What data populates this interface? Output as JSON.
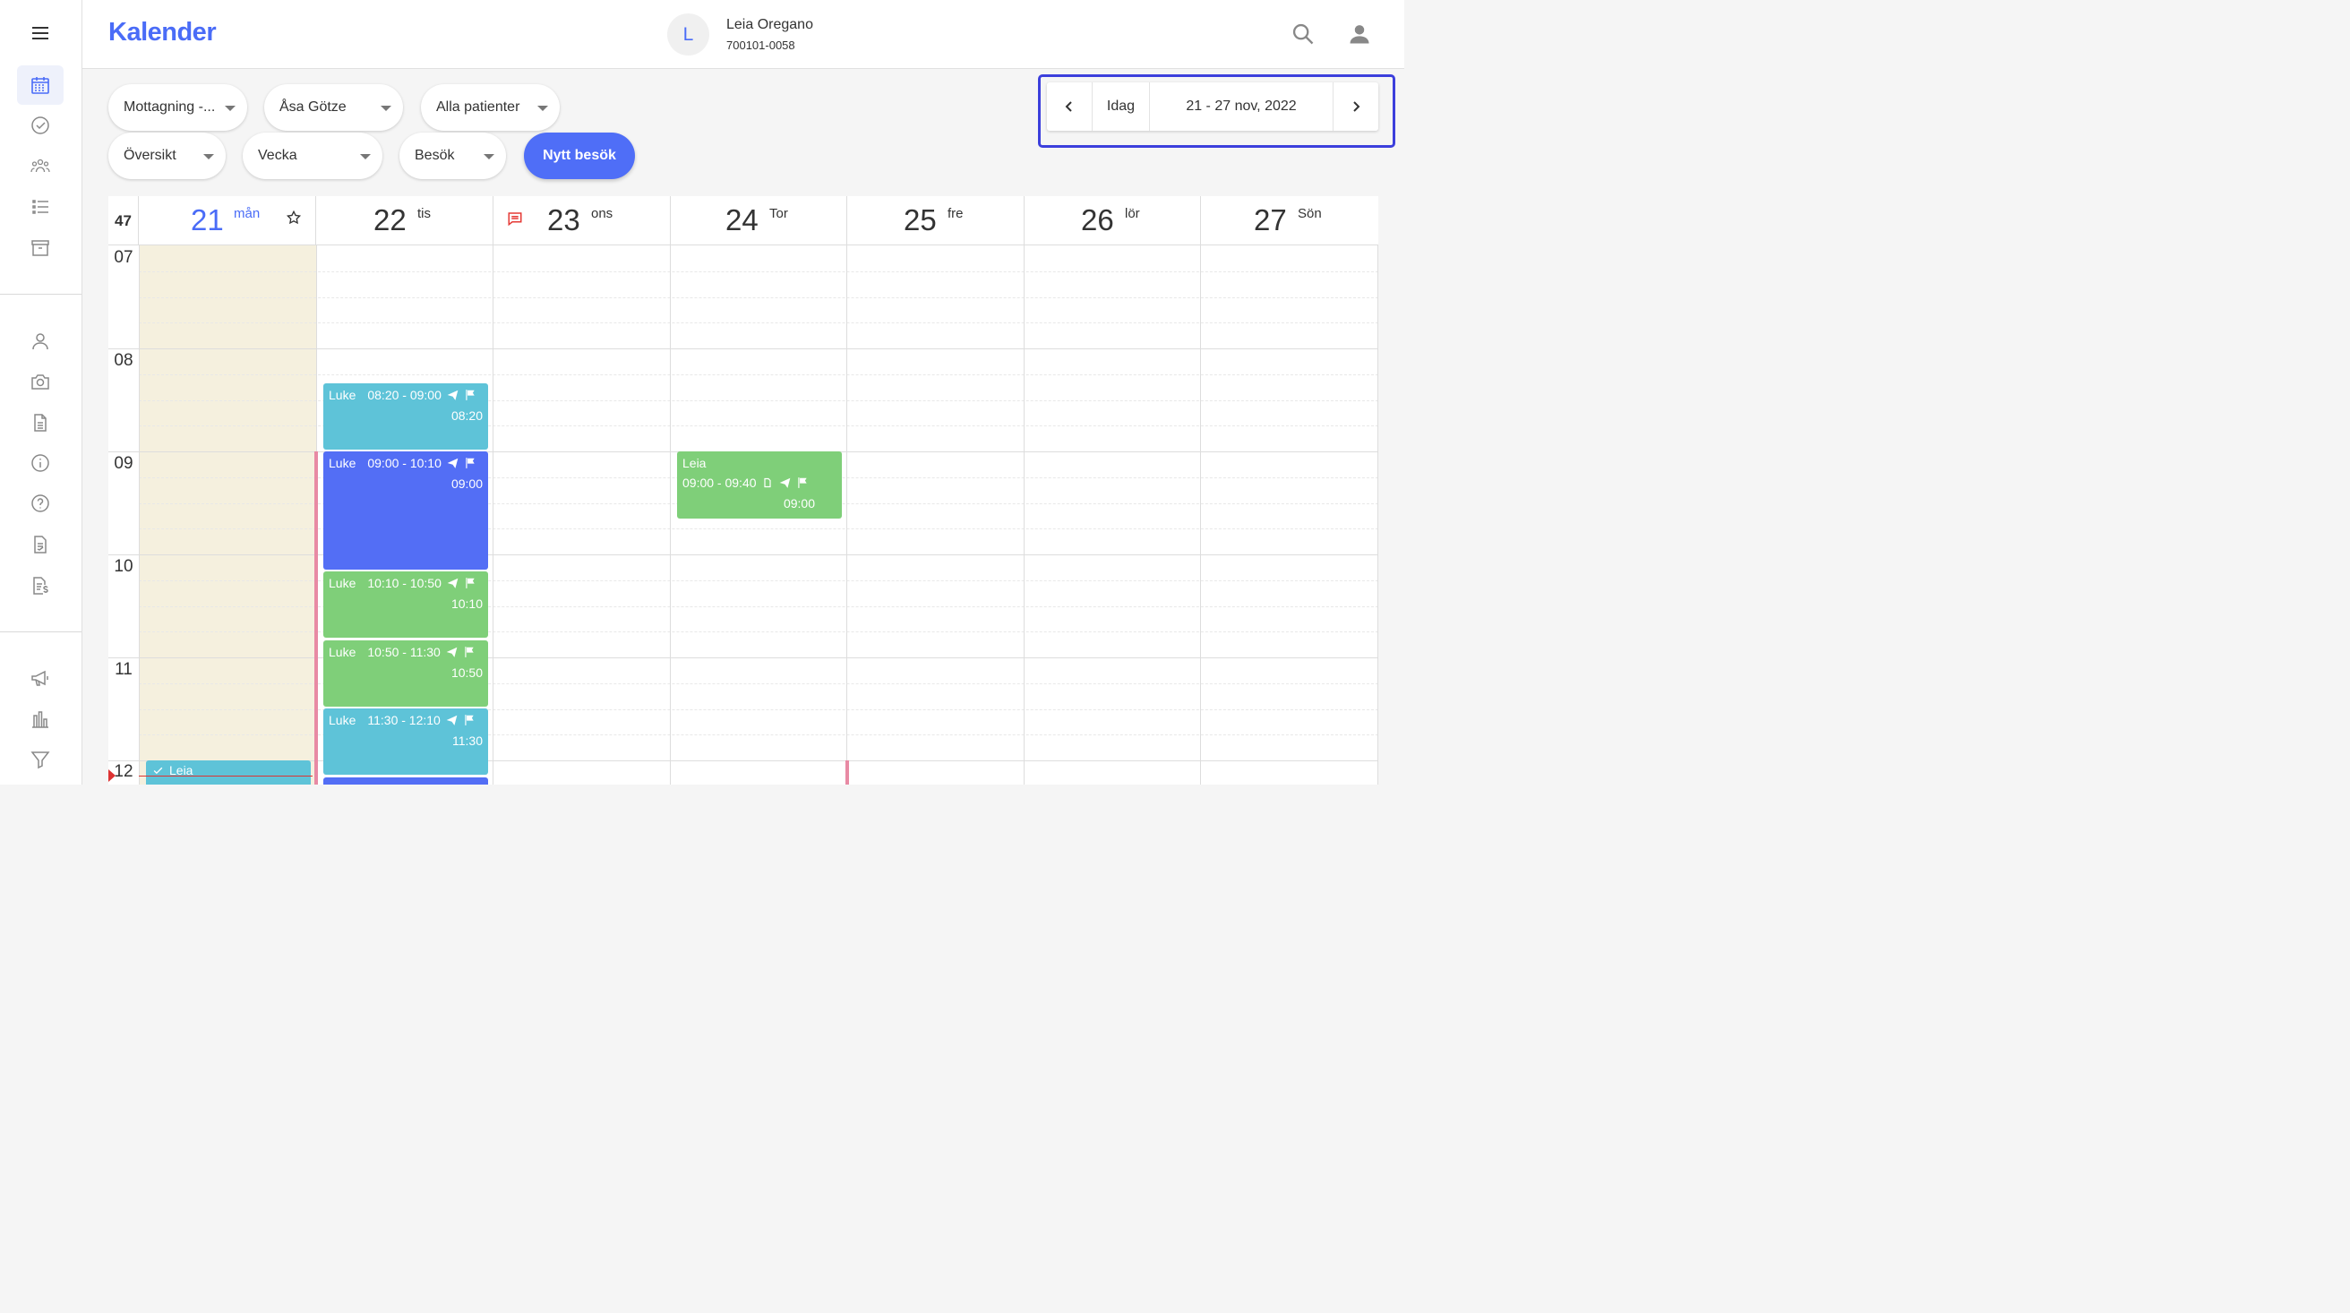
{
  "header": {
    "title": "Kalender",
    "patient": {
      "initial": "L",
      "name": "Leia Oregano",
      "id": "700101-0058"
    }
  },
  "sidebar": {
    "icons": [
      "menu-icon",
      "calendar-icon",
      "check-circle-icon",
      "group-icon",
      "list-icon",
      "archive-icon",
      "person-icon",
      "camera-icon",
      "document-icon",
      "info-icon",
      "help-icon",
      "report-icon",
      "invoice-icon",
      "megaphone-icon",
      "bar-chart-icon",
      "filter-icon"
    ]
  },
  "filters": {
    "clinic": "Mottagning -...",
    "practitioner": "Åsa Götze",
    "patients": "Alla patienter",
    "view": "Översikt",
    "period": "Vecka",
    "type": "Besök",
    "new_visit": "Nytt besök"
  },
  "week_nav": {
    "today": "Idag",
    "range": "21 - 27 nov, 2022"
  },
  "calendar": {
    "week_number": "47",
    "days": [
      {
        "num": "21",
        "name": "mån"
      },
      {
        "num": "22",
        "name": "tis"
      },
      {
        "num": "23",
        "name": "ons"
      },
      {
        "num": "24",
        "name": "Tor"
      },
      {
        "num": "25",
        "name": "fre"
      },
      {
        "num": "26",
        "name": "lör"
      },
      {
        "num": "27",
        "name": "Sön"
      }
    ],
    "hours": [
      "07",
      "08",
      "09",
      "10",
      "11",
      "12"
    ],
    "events": [
      {
        "who": "Luke",
        "time": "08:20 - 09:00",
        "start": "08:20"
      },
      {
        "who": "Luke",
        "time": "09:00 - 10:10",
        "start": "09:00"
      },
      {
        "who": "Luke",
        "time": "10:10 - 10:50",
        "start": "10:10"
      },
      {
        "who": "Luke",
        "time": "10:50 - 11:30",
        "start": "10:50"
      },
      {
        "who": "Luke",
        "time": "11:30 - 12:10",
        "start": "11:30"
      },
      {
        "who": "Leia",
        "time": "09:00 - 09:40",
        "start": "09:00"
      },
      {
        "who": "Leia"
      }
    ]
  },
  "colors": {
    "accent": "#4a6cf7",
    "event_blue": "#5ec3d8",
    "event_indigo": "#536ef5",
    "event_green": "#7fcf79",
    "today_bg": "#f5f0de"
  }
}
